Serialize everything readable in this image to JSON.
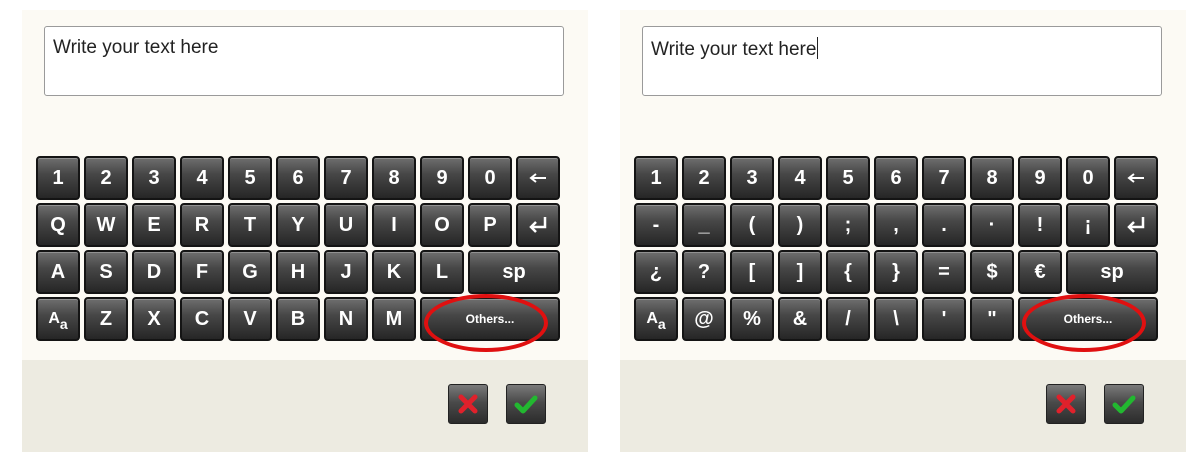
{
  "colors": {
    "panel_bg": "#fcfaf4",
    "bar_bg": "#edebe1",
    "key_bg": "#3a3a3a",
    "highlight": "#e01010",
    "cancel": "#e0212b",
    "confirm": "#22b830"
  },
  "panels": [
    {
      "textbox_value": "Write your text here",
      "cursor_visible": false,
      "rows": [
        [
          "1",
          "2",
          "3",
          "4",
          "5",
          "6",
          "7",
          "8",
          "9",
          "0",
          "←"
        ],
        [
          "Q",
          "W",
          "E",
          "R",
          "T",
          "Y",
          "U",
          "I",
          "O",
          "P",
          "↵"
        ],
        [
          "A",
          "S",
          "D",
          "F",
          "G",
          "H",
          "J",
          "K",
          "L",
          "sp"
        ],
        [
          "Aa",
          "Z",
          "X",
          "C",
          "V",
          "B",
          "N",
          "M",
          "Others..."
        ]
      ]
    },
    {
      "textbox_value": "Write your text here",
      "cursor_visible": true,
      "rows": [
        [
          "1",
          "2",
          "3",
          "4",
          "5",
          "6",
          "7",
          "8",
          "9",
          "0",
          "←"
        ],
        [
          "-",
          "_",
          "(",
          ")",
          ";",
          ",",
          ".",
          "·",
          "!",
          "¡",
          "↵"
        ],
        [
          "¿",
          "?",
          "[",
          "]",
          "{",
          "}",
          "=",
          "$",
          "€",
          "sp"
        ],
        [
          "Aa",
          "@",
          "%",
          "&",
          "/",
          "\\",
          "'",
          "\"",
          "Others..."
        ]
      ]
    }
  ],
  "actions": {
    "cancel_icon": "x-icon",
    "confirm_icon": "checkmark-icon"
  }
}
